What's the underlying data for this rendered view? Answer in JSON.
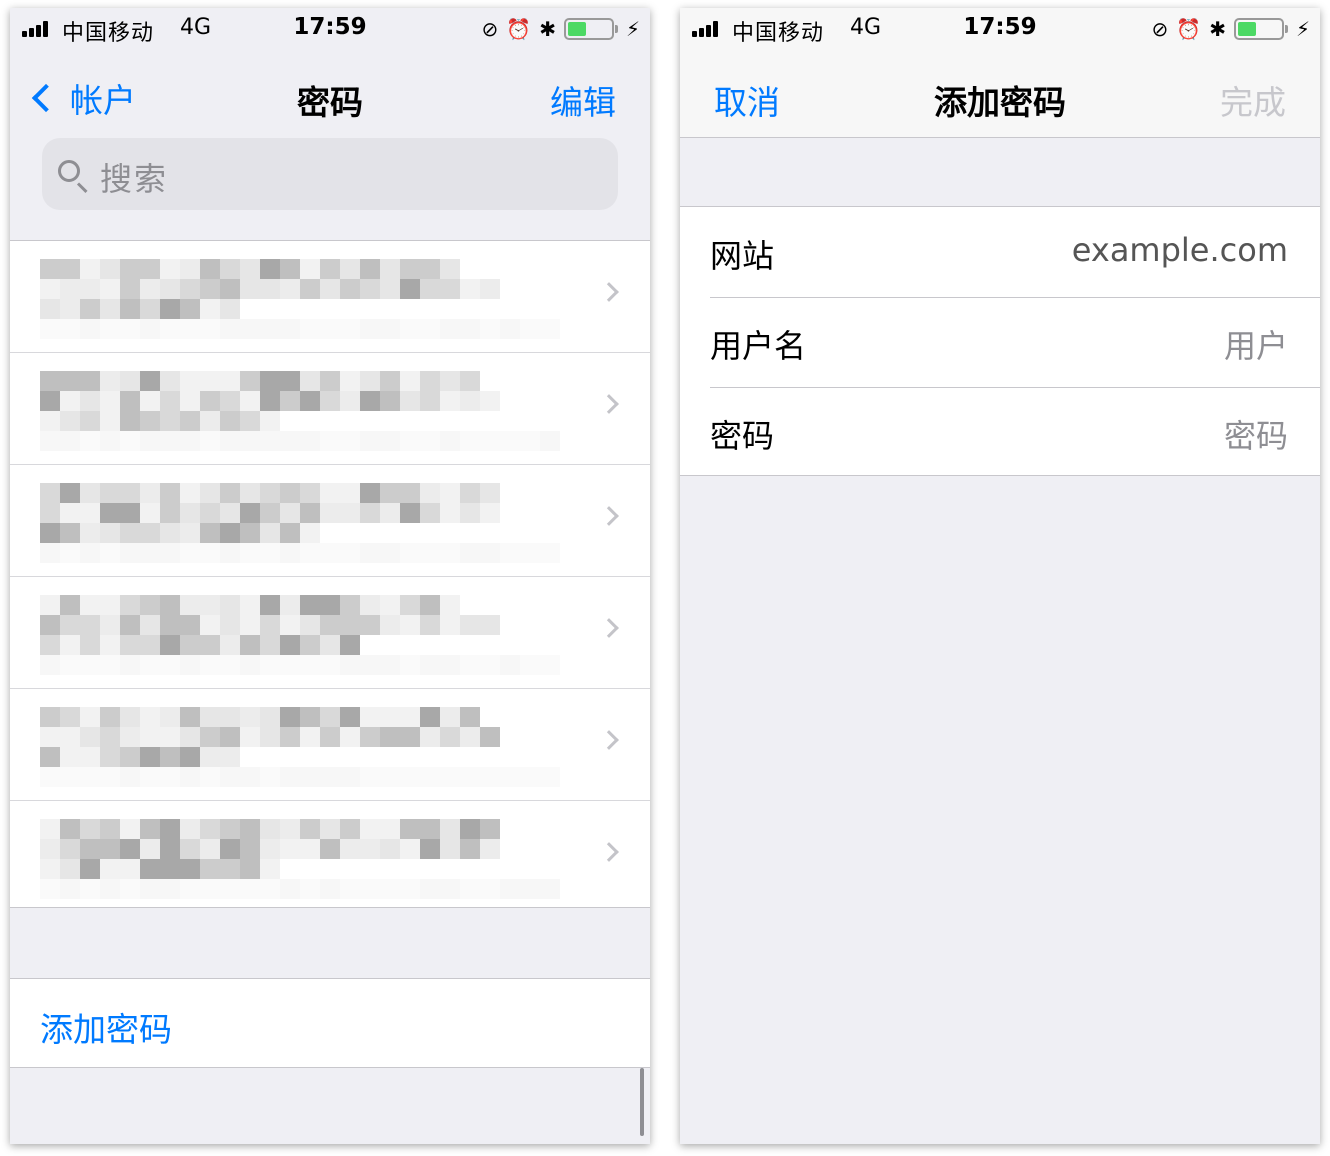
{
  "status_bar": {
    "carrier": "中国移动",
    "network": "4G",
    "time": "17:59",
    "battery_level": 0.4,
    "battery_color": "#4cd964",
    "icons": [
      "signal-icon",
      "rotation-lock-icon",
      "alarm-icon",
      "bluetooth-icon",
      "battery-icon",
      "charging-icon"
    ]
  },
  "left_screen": {
    "nav": {
      "back_label": "帐户",
      "title": "密码",
      "edit_label": "编辑"
    },
    "search": {
      "placeholder": "搜索"
    },
    "entries_count": 6,
    "add_password_label": "添加密码"
  },
  "right_screen": {
    "nav": {
      "cancel_label": "取消",
      "title": "添加密码",
      "done_label": "完成"
    },
    "form": {
      "website_label": "网站",
      "website_value": "example.com",
      "username_label": "用户名",
      "username_placeholder": "用户",
      "password_label": "密码",
      "password_placeholder": "密码"
    }
  },
  "colors": {
    "accent": "#007aff",
    "background": "#efeff4",
    "disabled": "#c7c7cc"
  }
}
